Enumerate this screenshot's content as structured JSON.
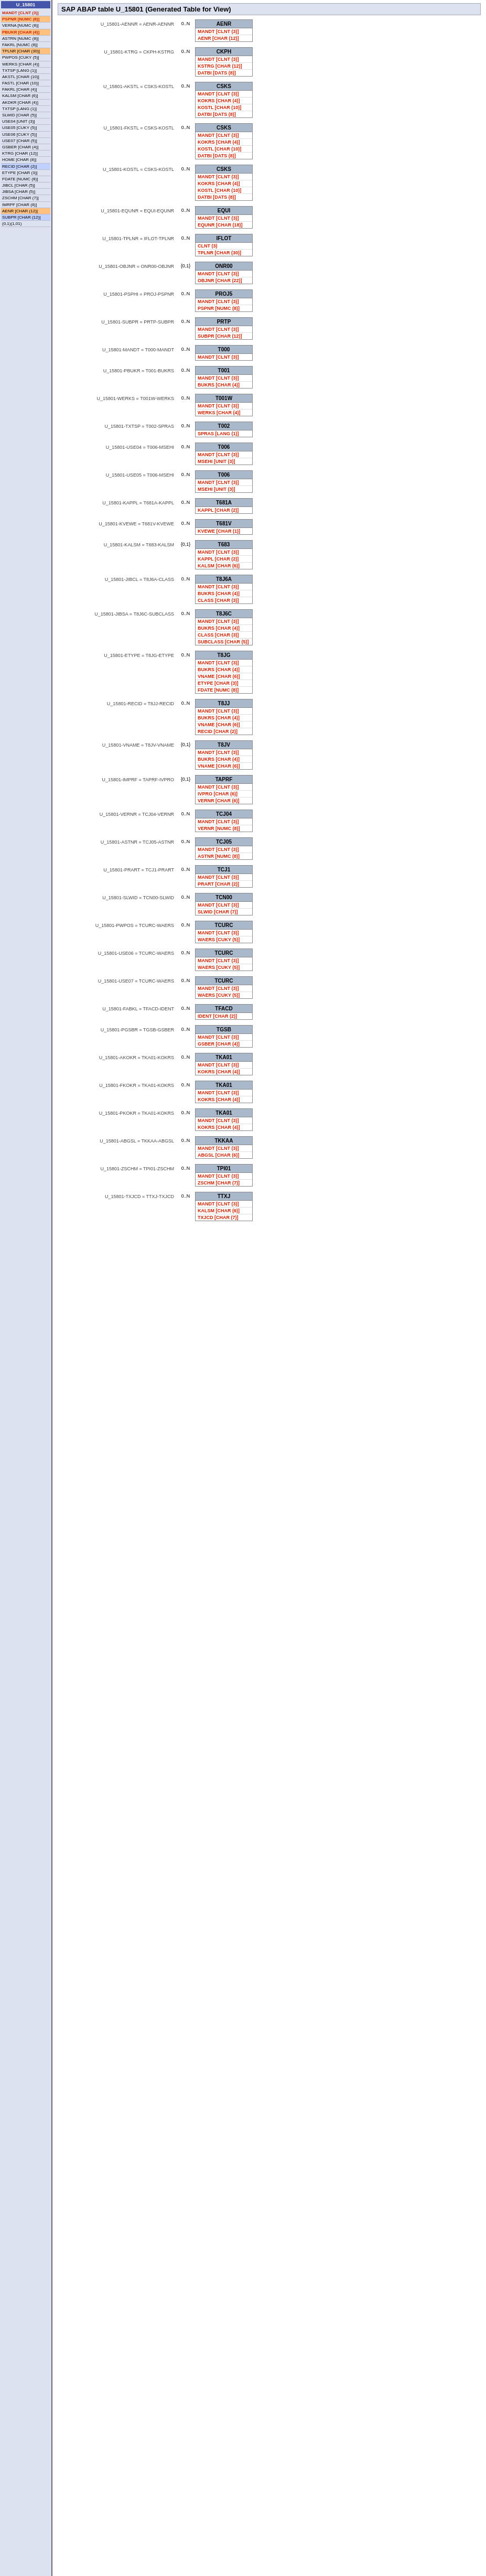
{
  "page": {
    "title": "SAP ABAP table U_15801 (Generated Table for View)"
  },
  "leftPanel": {
    "title": "U_15801",
    "fields": [
      {
        "name": "MANDT",
        "type": "CLNT (3)",
        "style": "red"
      },
      {
        "name": "PSPNR",
        "type": "NUMC (8)",
        "style": "red"
      },
      {
        "name": "VERNA",
        "type": "NUMC (8)",
        "style": ""
      },
      {
        "name": "PBUKR",
        "type": "CHAR (4)",
        "style": "red hl"
      },
      {
        "name": "ASTRN",
        "type": "NUMC (8)",
        "style": ""
      },
      {
        "name": "FAKRL",
        "type": "NUMC (8)",
        "style": ""
      },
      {
        "name": "TPLNR",
        "type": "CHAR (30)",
        "style": "hl"
      },
      {
        "name": "PWPOS",
        "type": "CUKY (5)",
        "style": ""
      },
      {
        "name": "WERKS",
        "type": "CHAR (4)",
        "style": ""
      },
      {
        "name": "TXTSP",
        "type": "LANG (1)",
        "style": ""
      },
      {
        "name": "AKSTL",
        "type": "CHAR (10)",
        "style": ""
      },
      {
        "name": "FASTL",
        "type": "CHAR (10)",
        "style": ""
      },
      {
        "name": "FAKRL",
        "type": "CHAR (4)",
        "style": ""
      },
      {
        "name": "KALSM",
        "type": "CHAR (6)",
        "style": ""
      },
      {
        "name": "AKDKR",
        "type": "CHAR (4)",
        "style": ""
      },
      {
        "name": "TXTSP",
        "type": "LANG (1)",
        "style": ""
      },
      {
        "name": "SLWID",
        "type": "CHAR (5)",
        "style": ""
      },
      {
        "name": "USE04",
        "type": "UNIT (3)",
        "style": ""
      },
      {
        "name": "USE05",
        "type": "CUKY (5)",
        "style": ""
      },
      {
        "name": "USE06",
        "type": "CUKY (5)",
        "style": ""
      },
      {
        "name": "USE07",
        "type": "CHAR (5)",
        "style": ""
      },
      {
        "name": "GSBER",
        "type": "CHAR (4)",
        "style": ""
      },
      {
        "name": "KTRG",
        "type": "CHAR (12)",
        "style": ""
      },
      {
        "name": "HOME",
        "type": "CHAR (8)",
        "style": ""
      },
      {
        "name": "RECID",
        "type": "CHAR (2)",
        "style": "hl2"
      },
      {
        "name": "ETYPE",
        "type": "CHAR (3)",
        "style": ""
      },
      {
        "name": "FDATE",
        "type": "NUMC (8)",
        "style": ""
      },
      {
        "name": "JIBCL",
        "type": "CHAR (5)",
        "style": ""
      },
      {
        "name": "JIBSA",
        "type": "CHAR (5)",
        "style": ""
      },
      {
        "name": "ZSCHM",
        "type": "CHAR (7)",
        "style": ""
      },
      {
        "name": "IMRPF",
        "type": "CHAR (6)",
        "style": ""
      },
      {
        "name": "AENR",
        "type": "CHAR (12)",
        "style": "hl"
      },
      {
        "name": "SUBPR",
        "type": "CHAR (12)",
        "style": "hl2"
      },
      {
        "name": "(0,1)(1,01)",
        "type": "",
        "style": ""
      }
    ]
  },
  "relations": [
    {
      "fieldRef": "U_15801-AENNR = AENR-AENNR",
      "card": "0..N",
      "tableName": "AENR",
      "rows": [
        {
          "text": "MANDT [CLNT (3)]",
          "style": "red"
        },
        {
          "text": "AENR [CHAR (12)]",
          "style": "red"
        }
      ]
    },
    {
      "fieldRef": "U_15801-KTRG = CKPH-KSTRG",
      "card": "0..N",
      "tableName": "CKPH",
      "rows": [
        {
          "text": "MANDT [CLNT (3)]",
          "style": "red"
        },
        {
          "text": "KSTRG [CHAR (12)]",
          "style": "red"
        },
        {
          "text": "DATBI [DATS (8)]",
          "style": "red"
        }
      ]
    },
    {
      "fieldRef": "U_15801-AKSTL = CSKS-KOSTL",
      "card": "0..N",
      "tableName": "CSKS",
      "rows": [
        {
          "text": "MANDT [CLNT (3)]",
          "style": "red"
        },
        {
          "text": "KOKRS [CHAR (4)]",
          "style": "red"
        },
        {
          "text": "KOSTL [CHAR (10)]",
          "style": "red"
        },
        {
          "text": "DATBI [DATS (8)]",
          "style": "red"
        }
      ]
    },
    {
      "fieldRef": "U_15801-FKSTL = CSKS-KOSTL",
      "card": "0..N",
      "tableName": "CSKS",
      "rows": [
        {
          "text": "MANDT [CLNT (3)]",
          "style": "red"
        },
        {
          "text": "KOKRS [CHAR (4)]",
          "style": "red"
        },
        {
          "text": "KOSTL [CHAR (10)]",
          "style": "red"
        },
        {
          "text": "DATBI [DATS (8)]",
          "style": "red"
        }
      ]
    },
    {
      "fieldRef": "U_15801-KOSTL = CSKS-KOSTL",
      "card": "0..N",
      "tableName": "CSKS",
      "rows": [
        {
          "text": "MANDT [CLNT (3)]",
          "style": "red"
        },
        {
          "text": "KOKRS [CHAR (4)]",
          "style": "red"
        },
        {
          "text": "KOSTL [CHAR (10)]",
          "style": "red"
        },
        {
          "text": "DATBI [DATS (8)]",
          "style": "red"
        }
      ]
    },
    {
      "fieldRef": "U_15801-EQUNR = EQUI-EQUNR",
      "card": "0..N",
      "tableName": "EQUI",
      "rows": [
        {
          "text": "MANDT [CLNT (3)]",
          "style": "red"
        },
        {
          "text": "EQUNR [CHAR (18)]",
          "style": "red"
        }
      ]
    },
    {
      "fieldRef": "U_15801-TPLNR = IFLOT-TPLNR",
      "card": "0..N",
      "tableName": "IFLOT",
      "rows": [
        {
          "text": "CLNT (3)",
          "style": "red"
        },
        {
          "text": "TPLNR [CHAR (30)]",
          "style": "red"
        }
      ]
    },
    {
      "fieldRef": "U_15801-OBJNR = ONR00-OBJNR",
      "card": "{0,1}",
      "tableName": "ONR00",
      "rows": [
        {
          "text": "MANDT [CLNT (3)]",
          "style": "red"
        },
        {
          "text": "OBJNR [CHAR (22)]",
          "style": "red"
        }
      ]
    },
    {
      "fieldRef": "U_15801-PSPHI = PROJ-PSPNR",
      "card": "0..N",
      "tableName": "PROJ5",
      "rows": [
        {
          "text": "MANDT [CLNT (3)]",
          "style": "red"
        },
        {
          "text": "PSPNR [NUMC (8)]",
          "style": "red"
        }
      ]
    },
    {
      "fieldRef": "U_15801-SUBPR = PRTP-SUBPR",
      "card": "0..N",
      "tableName": "PRTP",
      "rows": [
        {
          "text": "MANDT [CLNT (3)]",
          "style": "red"
        },
        {
          "text": "SUBPR [CHAR (12)]",
          "style": "red"
        }
      ]
    },
    {
      "fieldRef": "U_15801-MANDT = T000-MANDT",
      "card": "0..N",
      "tableName": "T000",
      "rows": [
        {
          "text": "MANDT [CLNT (3)]",
          "style": "red"
        }
      ]
    },
    {
      "fieldRef": "U_15801-PBUKR = T001-BUKRS",
      "card": "0..N",
      "tableName": "T001",
      "rows": [
        {
          "text": "MANDT [CLNT (3)]",
          "style": "red"
        },
        {
          "text": "BUKRS [CHAR (4)]",
          "style": "red"
        }
      ]
    },
    {
      "fieldRef": "U_15801-WERKS = T001W-WERKS",
      "card": "0..N",
      "tableName": "T001W",
      "rows": [
        {
          "text": "MANDT [CLNT (3)]",
          "style": "red"
        },
        {
          "text": "WERKS [CHAR (4)]",
          "style": "red"
        }
      ]
    },
    {
      "fieldRef": "U_15801-TXTSP = T002-SPRAS",
      "card": "0..N",
      "tableName": "T002",
      "rows": [
        {
          "text": "SPRAS [LANG (1)]",
          "style": "red"
        }
      ]
    },
    {
      "fieldRef": "U_15801-USE04 = T006-MSEHI",
      "card": "0..N",
      "tableName": "T006",
      "rows": [
        {
          "text": "MANDT [CLNT (3)]",
          "style": "red"
        },
        {
          "text": "MSEHI [UNIT (3)]",
          "style": "red"
        }
      ]
    },
    {
      "fieldRef": "U_15801-USE05 = T006-MSEHI",
      "card": "0..N",
      "tableName": "T006",
      "rows": [
        {
          "text": "MANDT [CLNT (3)]",
          "style": "red"
        },
        {
          "text": "MSEHI [UNIT (3)]",
          "style": "red"
        }
      ]
    },
    {
      "fieldRef": "U_15801-KAPPL = T681A-KAPPL",
      "card": "0..N",
      "tableName": "T681A",
      "rows": [
        {
          "text": "KAPPL [CHAR (2)]",
          "style": "red"
        }
      ]
    },
    {
      "fieldRef": "U_15801-KVEWE = T681V-KVEWE",
      "card": "0..N",
      "tableName": "T681V",
      "rows": [
        {
          "text": "KVEWE [CHAR (1)]",
          "style": "red"
        }
      ]
    },
    {
      "fieldRef": "U_15801-KALSM = T683-KALSM",
      "card": "{0,1}",
      "tableName": "T683",
      "rows": [
        {
          "text": "MANDT [CLNT (3)]",
          "style": "red"
        },
        {
          "text": "KAPPL [CHAR (2)]",
          "style": "red"
        },
        {
          "text": "KALSM [CHAR (6)]",
          "style": "red"
        }
      ]
    },
    {
      "fieldRef": "U_15801-JIBCL = T8J6A-CLASS",
      "card": "0..N",
      "tableName": "T8J6A",
      "rows": [
        {
          "text": "MANDT [CLNT (3)]",
          "style": "red"
        },
        {
          "text": "BUKRS [CHAR (4)]",
          "style": "red"
        },
        {
          "text": "CLASS [CHAR (3)]",
          "style": "red"
        }
      ]
    },
    {
      "fieldRef": "U_15801-JIBSA = T8J6C-SUBCLASS",
      "card": "0..N",
      "tableName": "T8J6C",
      "rows": [
        {
          "text": "MANDT [CLNT (3)]",
          "style": "red"
        },
        {
          "text": "BUKRS [CHAR (4)]",
          "style": "red"
        },
        {
          "text": "CLASS [CHAR (3)]",
          "style": "red"
        },
        {
          "text": "SUBCLASS [CHAR (5)]",
          "style": "red"
        }
      ]
    },
    {
      "fieldRef": "U_15801-ETYPE = T8JG-ETYPE",
      "card": "0..N",
      "tableName": "T8JG",
      "rows": [
        {
          "text": "MANDT [CLNT (3)]",
          "style": "red"
        },
        {
          "text": "BUKRS [CHAR (4)]",
          "style": "red"
        },
        {
          "text": "VNAME [CHAR (6)]",
          "style": "red"
        },
        {
          "text": "ETYPE [CHAR (3)]",
          "style": "red"
        },
        {
          "text": "FDATE [NUMC (8)]",
          "style": "red"
        }
      ]
    },
    {
      "fieldRef": "U_15801-RECID = T8JJ-RECID",
      "card": "0..N",
      "tableName": "T8JJ",
      "rows": [
        {
          "text": "MANDT [CLNT (3)]",
          "style": "red"
        },
        {
          "text": "BUKRS [CHAR (4)]",
          "style": "red"
        },
        {
          "text": "VNAME [CHAR (6)]",
          "style": "red"
        },
        {
          "text": "RECID [CHAR (2)]",
          "style": "red"
        }
      ]
    },
    {
      "fieldRef": "U_15801-VNAME = T8JV-VNAME",
      "card": "{0,1}",
      "tableName": "T8JV",
      "rows": [
        {
          "text": "MANDT [CLNT (3)]",
          "style": "red"
        },
        {
          "text": "BUKRS [CHAR (4)]",
          "style": "red"
        },
        {
          "text": "VNAME [CHAR (6)]",
          "style": "red"
        }
      ]
    },
    {
      "fieldRef": "U_15801-IMPRF = TAPRF-IVPRO",
      "card": "{0,1}",
      "tableName": "TAPRF",
      "rows": [
        {
          "text": "MANDT [CLNT (3)]",
          "style": "red"
        },
        {
          "text": "IVPRO [CHAR (6)]",
          "style": "red"
        },
        {
          "text": "VERNR [CHAR (6)]",
          "style": "red"
        }
      ]
    },
    {
      "fieldRef": "U_15801-VERNR = TCJ04-VERNR",
      "card": "0..N",
      "tableName": "TCJ04",
      "rows": [
        {
          "text": "MANDT [CLNT (3)]",
          "style": "red"
        },
        {
          "text": "VERNR [NUMC (8)]",
          "style": "red"
        }
      ]
    },
    {
      "fieldRef": "U_15801-ASTNR = TCJ05-ASTNR",
      "card": "0..N",
      "tableName": "TCJ05",
      "rows": [
        {
          "text": "MANDT [CLNT (3)]",
          "style": "red"
        },
        {
          "text": "ASTNR [NUMC (8)]",
          "style": "red"
        }
      ]
    },
    {
      "fieldRef": "U_15801-PRART = TCJ1-PRART",
      "card": "0..N",
      "tableName": "TCJ1",
      "rows": [
        {
          "text": "MANDT [CLNT (3)]",
          "style": "red"
        },
        {
          "text": "PRART [CHAR (2)]",
          "style": "red"
        }
      ]
    },
    {
      "fieldRef": "U_15801-SLWID = TCN00-SLWID",
      "card": "0..N",
      "tableName": "TCN00",
      "rows": [
        {
          "text": "MANDT [CLNT (3)]",
          "style": "red"
        },
        {
          "text": "SLWID [CHAR (7)]",
          "style": "red"
        }
      ]
    },
    {
      "fieldRef": "U_15801-PWPOS = TCURC-WAERS",
      "card": "0..N",
      "tableName": "TCURC",
      "rows": [
        {
          "text": "MANDT [CLNT (3)]",
          "style": "red"
        },
        {
          "text": "WAERS [CUKY (5)]",
          "style": "red"
        }
      ]
    },
    {
      "fieldRef": "U_15801-USE06 = TCURC-WAERS",
      "card": "0..N",
      "tableName": "TCURC",
      "rows": [
        {
          "text": "MANDT [CLNT (3)]",
          "style": "red"
        },
        {
          "text": "WAERS [CUKY (5)]",
          "style": "red"
        }
      ]
    },
    {
      "fieldRef": "U_15801-USE07 = TCURC-WAERS",
      "card": "0..N",
      "tableName": "TCURC",
      "rows": [
        {
          "text": "MANDT [CLNT (3)]",
          "style": "red"
        },
        {
          "text": "WAERS [CUKY (5)]",
          "style": "red"
        }
      ]
    },
    {
      "fieldRef": "U_15801-FABKL = TFACD-IDENT",
      "card": "0..N",
      "tableName": "TFACD",
      "rows": [
        {
          "text": "IDENT [CHAR (2)]",
          "style": "red"
        }
      ]
    },
    {
      "fieldRef": "U_15801-PGSBR = TGSB-GSBER",
      "card": "0..N",
      "tableName": "TGSB",
      "rows": [
        {
          "text": "MANDT [CLNT (3)]",
          "style": "red"
        },
        {
          "text": "GSBER [CHAR (4)]",
          "style": "red"
        }
      ]
    },
    {
      "fieldRef": "U_15801-AKOKR = TKA01-KOKRS",
      "card": "0..N",
      "tableName": "TKA01",
      "rows": [
        {
          "text": "MANDT [CLNT (3)]",
          "style": "red"
        },
        {
          "text": "KOKRS [CHAR (4)]",
          "style": "red"
        }
      ]
    },
    {
      "fieldRef": "U_15801-FKOKR = TKA01-KOKRS",
      "card": "0..N",
      "tableName": "TKA01",
      "rows": [
        {
          "text": "MANDT [CLNT (3)]",
          "style": "red"
        },
        {
          "text": "KOKRS [CHAR (4)]",
          "style": "red"
        }
      ]
    },
    {
      "fieldRef": "U_15801-PKOKR = TKA01-KOKRS",
      "card": "0..N",
      "tableName": "TKA01",
      "rows": [
        {
          "text": "MANDT [CLNT (3)]",
          "style": "red"
        },
        {
          "text": "KOKRS [CHAR (4)]",
          "style": "red"
        }
      ]
    },
    {
      "fieldRef": "U_15801-ABGSL = TKKAA-ABGSL",
      "card": "0..N",
      "tableName": "TKKAA",
      "rows": [
        {
          "text": "MANDT [CLNT (3)]",
          "style": "red"
        },
        {
          "text": "ABGSL [CHAR (6)]",
          "style": "red"
        }
      ]
    },
    {
      "fieldRef": "U_15801-ZSCHM = TPI01-ZSCHM",
      "card": "0..N",
      "tableName": "TPI01",
      "rows": [
        {
          "text": "MANDT [CLNT (3)]",
          "style": "red"
        },
        {
          "text": "ZSCHM [CHAR (7)]",
          "style": "red"
        }
      ]
    },
    {
      "fieldRef": "U_15801-TXJCD = TTXJ-TXJCD",
      "card": "0..N",
      "tableName": "TTXJ",
      "rows": [
        {
          "text": "MANDT [CLNT (3)]",
          "style": "red"
        },
        {
          "text": "KALSM [CHAR (6)]",
          "style": "red"
        },
        {
          "text": "TXJCD [CHAR (7)]",
          "style": "red"
        }
      ]
    }
  ]
}
